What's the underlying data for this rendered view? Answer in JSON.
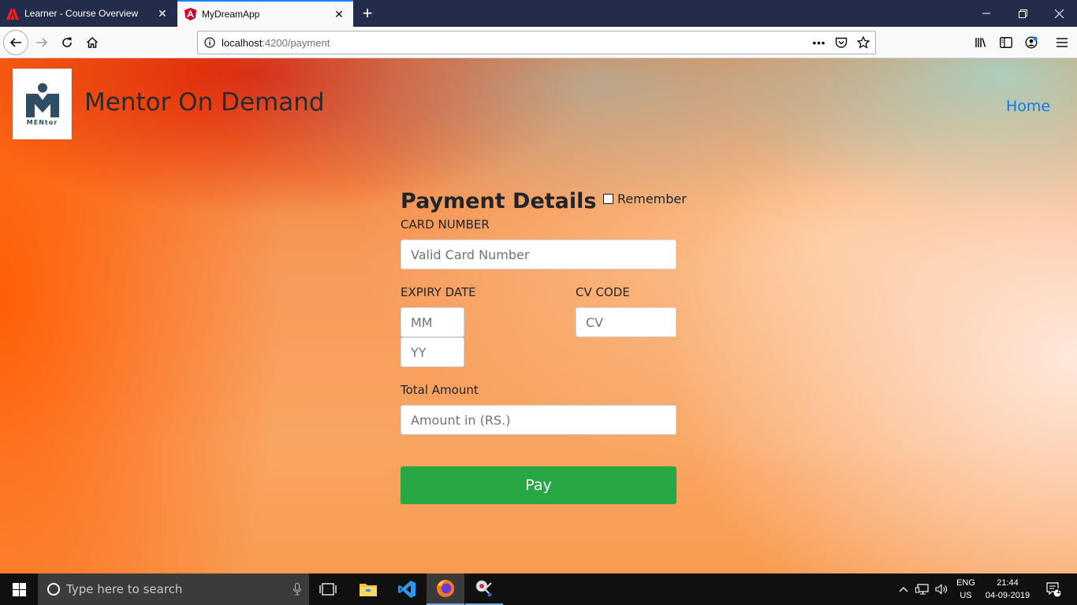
{
  "browser": {
    "tabs": [
      {
        "title": "Learner - Course Overview",
        "favicon": "adobe-icon",
        "active": false
      },
      {
        "title": "MyDreamApp",
        "favicon": "angular-icon",
        "active": true
      }
    ],
    "url_host": "localhost",
    "url_path": ":4200/payment"
  },
  "header": {
    "brand": "Mentor On Demand",
    "logo_text": "MENtor",
    "nav_home": "Home"
  },
  "form": {
    "title": "Payment Details",
    "remember_label": "Remember",
    "card_label": "CARD NUMBER",
    "card_placeholder": "Valid Card Number",
    "expiry_label": "EXPIRY DATE",
    "month_placeholder": "MM",
    "year_placeholder": "YY",
    "cv_label": "CV CODE",
    "cv_placeholder": "CV",
    "amount_label": "Total Amount",
    "amount_placeholder": "Amount in (RS.)",
    "pay_label": "Pay"
  },
  "taskbar": {
    "search_placeholder": "Type here to search",
    "lang_top": "ENG",
    "lang_bottom": "US",
    "time": "21:44",
    "date": "04-09-2019",
    "notification_count": "1"
  },
  "colors": {
    "accent": "#0a84ff",
    "pay_button": "#28a745",
    "home_link": "#0a7cf0"
  }
}
